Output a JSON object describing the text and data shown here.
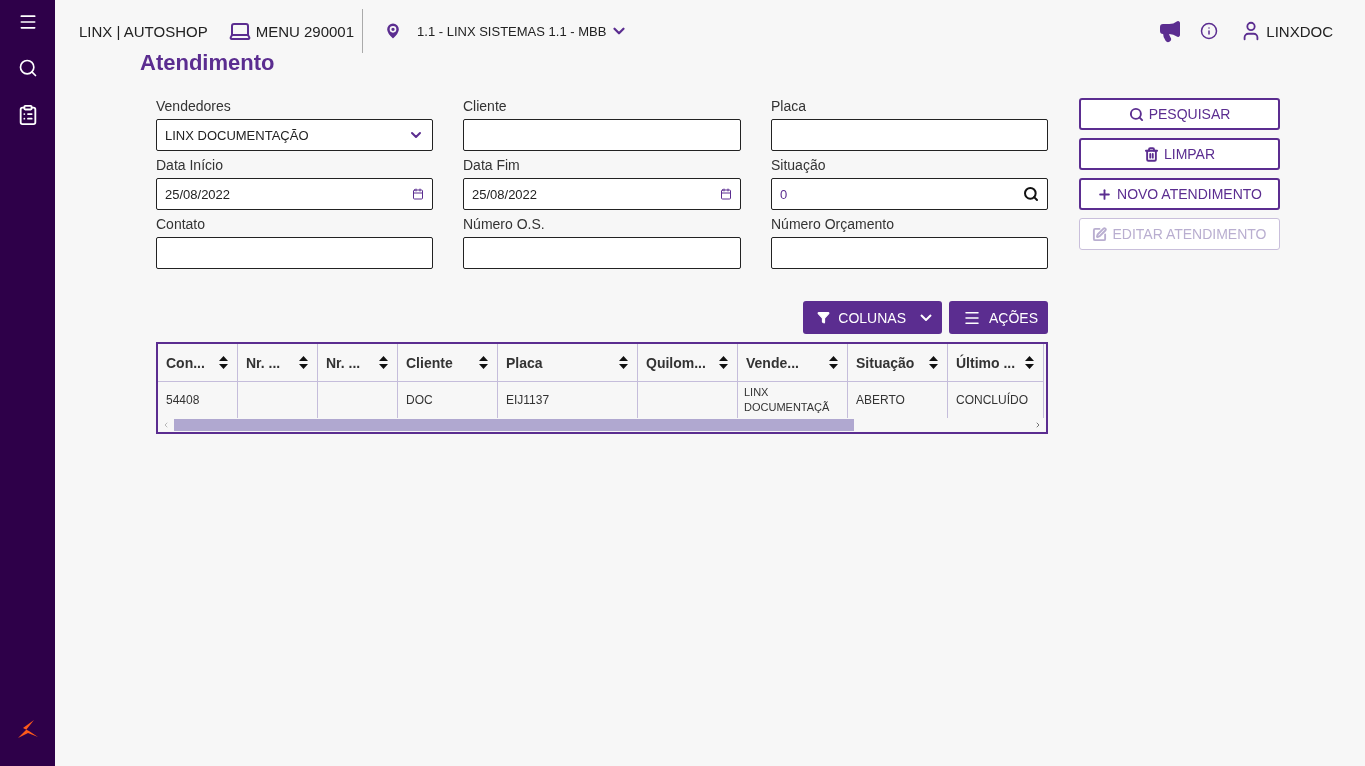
{
  "header": {
    "brand": "LINX | AUTOSHOP",
    "menu": "MENU 290001",
    "company": "1.1 - LINX SISTEMAS 1.1 - MBB",
    "user": "LINXDOC"
  },
  "page_title": "Atendimento",
  "fields": [
    {
      "label": "Vendedores",
      "kind": "select",
      "value": "LINX DOCUMENTAÇÃO"
    },
    {
      "label": "Cliente",
      "kind": "text"
    },
    {
      "label": "Placa",
      "kind": "text"
    },
    {
      "label": "Data Início",
      "kind": "date",
      "value": "25/08/2022"
    },
    {
      "label": "Data Fim",
      "kind": "date",
      "value": "25/08/2022"
    },
    {
      "label": "Situação",
      "kind": "search",
      "value": "0"
    },
    {
      "label": "Contato",
      "kind": "text"
    },
    {
      "label": "Número O.S.",
      "kind": "text"
    },
    {
      "label": "Número Orçamento",
      "kind": "text"
    }
  ],
  "actions": [
    {
      "label": "PESQUISAR",
      "kind": "search",
      "disabled": false
    },
    {
      "label": "LIMPAR",
      "kind": "trash",
      "disabled": false
    },
    {
      "label": "NOVO ATENDIMENTO",
      "kind": "plus",
      "disabled": false
    },
    {
      "label": "EDITAR ATENDIMENTO",
      "kind": "edit",
      "disabled": true
    }
  ],
  "table_buttons": {
    "columns": "COLUNAS",
    "actions": "AÇÕES"
  },
  "table": {
    "columns": [
      "Con...",
      "Nr. ...",
      "Nr. ...",
      "Cliente",
      "Placa",
      "Quilom...",
      "Vende...",
      "Situação",
      "Último ..."
    ],
    "rows": [
      [
        "54408",
        "",
        "",
        "DOC",
        "EIJ1137",
        "",
        "LINX DOCUMENTAÇÃ",
        "ABERTO",
        "CONCLUÍDO"
      ]
    ]
  }
}
